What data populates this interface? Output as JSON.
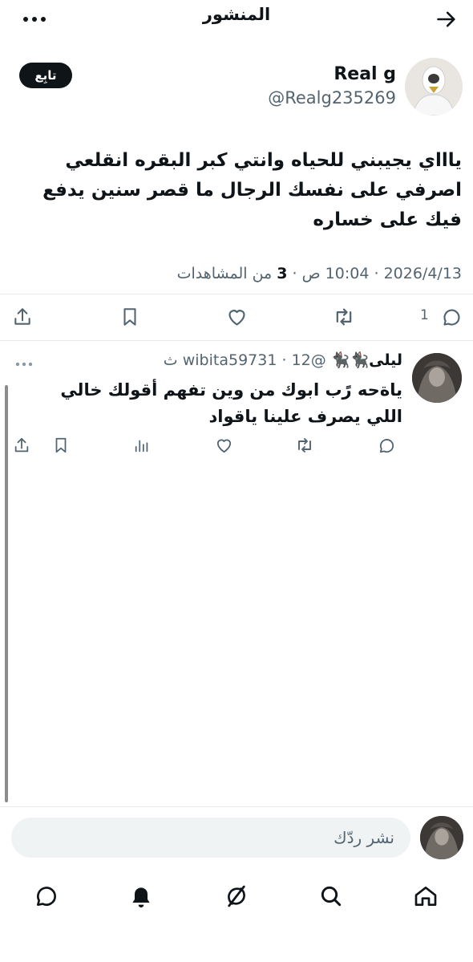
{
  "header": {
    "title": "المنشور"
  },
  "post": {
    "author_name": "Real g",
    "author_handle": "@Realg235269",
    "follow_label": "تابِع",
    "text_lines": [
      "ياااي يجيبني للحياه وانتي كبر البقره انقلعي",
      "اصرفي على نفسك الرجال ما قصر سنين يدفع",
      "فيك على خساره"
    ],
    "date": "2026/4/13",
    "time": "10:04 ص",
    "views_count": "3",
    "views_label": "من المشاهدات",
    "reply_count": "1"
  },
  "reply": {
    "author_name": "ليلى🐈‍⬛🐈‍⬛",
    "author_handle": "@wibita59731",
    "age": "12 ث",
    "text_lines": [
      "ياةحه رًب ابوك من وين تفهم أقولك خالي",
      "اللي يصرف علينا ياقواد"
    ]
  },
  "composer": {
    "placeholder": "نشر ردّك"
  },
  "icons": {
    "back": "arrow-right-icon",
    "more": "more-horizontal-icon",
    "share": "share-icon",
    "bookmark": "bookmark-icon",
    "like": "heart-icon",
    "retweet": "retweet-icon",
    "reply": "reply-icon",
    "views": "analytics-icon",
    "nav": [
      "home-icon",
      "search-icon",
      "grok-icon",
      "notifications-icon",
      "messages-icon"
    ]
  },
  "colors": {
    "text_primary": "#0f1419",
    "text_secondary": "#536471",
    "follow_bg": "#0f1419",
    "input_bg": "#eff3f4"
  }
}
